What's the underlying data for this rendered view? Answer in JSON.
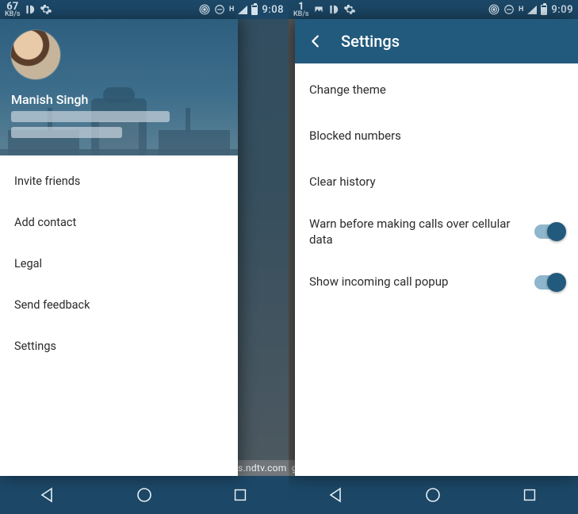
{
  "watermark_text": "gadgets.ndtv.com",
  "left": {
    "status": {
      "kbs_num": "67",
      "kbs_unit": "KB/s",
      "time": "9:08",
      "net_letter": "H"
    },
    "user_name": "Manish Singh",
    "menu": [
      {
        "label": "Invite friends"
      },
      {
        "label": "Add contact"
      },
      {
        "label": "Legal"
      },
      {
        "label": "Send feedback"
      },
      {
        "label": "Settings"
      }
    ]
  },
  "right": {
    "status": {
      "kbs_num": "1",
      "kbs_unit": "KB/s",
      "time": "9:09",
      "net_letter": "H"
    },
    "header_title": "Settings",
    "items": [
      {
        "label": "Change theme",
        "toggle": null
      },
      {
        "label": "Blocked numbers",
        "toggle": null
      },
      {
        "label": "Clear history",
        "toggle": null
      },
      {
        "label": "Warn before making calls over cellular data",
        "toggle": true
      },
      {
        "label": "Show incoming call popup",
        "toggle": true
      }
    ]
  }
}
